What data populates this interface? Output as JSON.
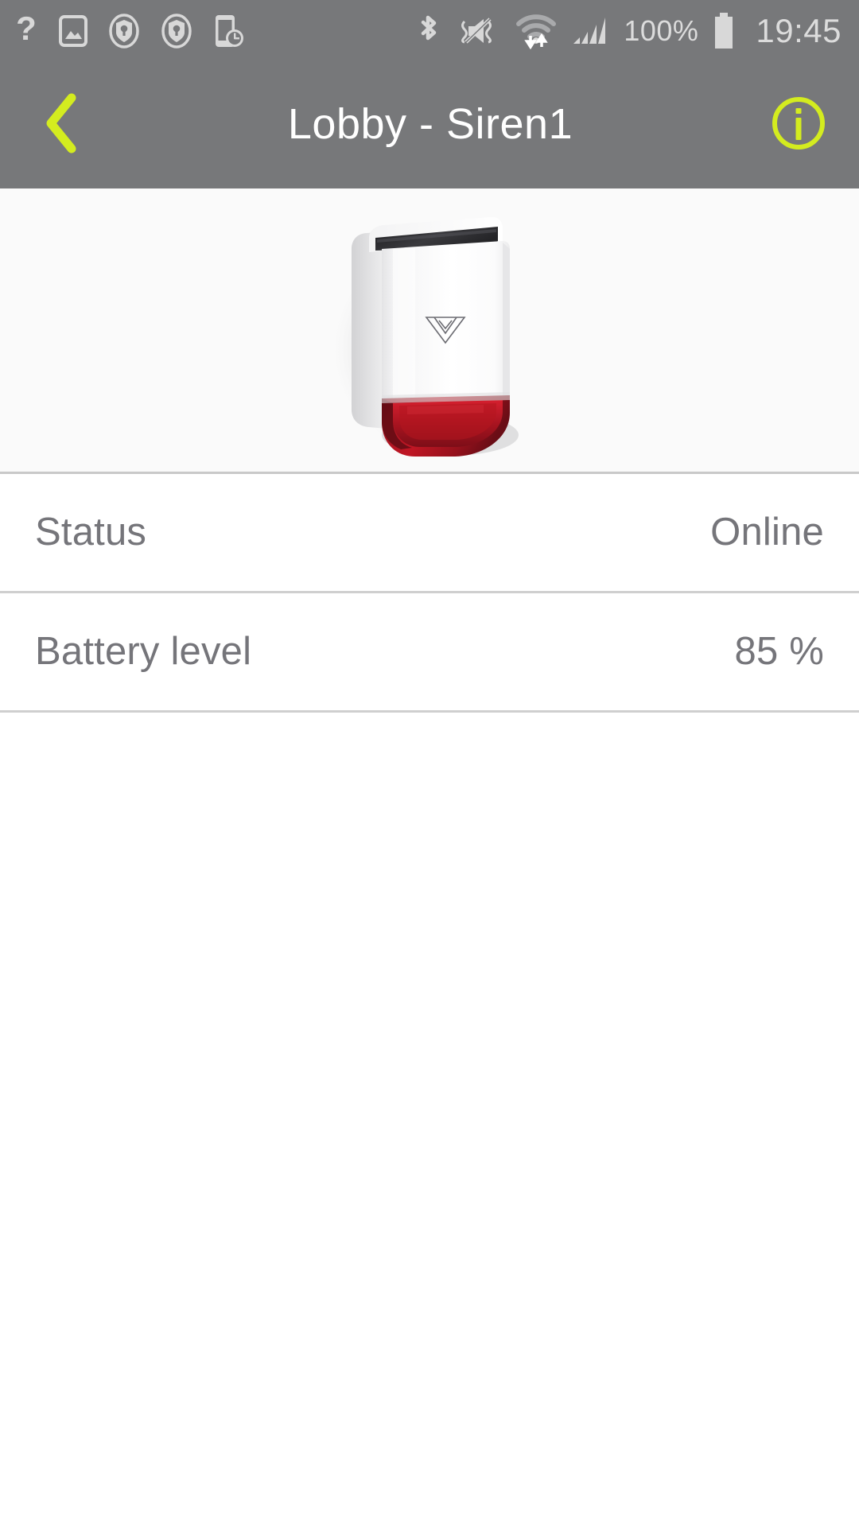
{
  "status_bar": {
    "time": "19:45",
    "battery_percent": "100%",
    "left_icons": [
      {
        "name": "help-question-icon"
      },
      {
        "name": "screenshot-image-icon"
      },
      {
        "name": "shield-key-icon-1"
      },
      {
        "name": "shield-key-icon-2"
      },
      {
        "name": "phone-clock-icon"
      }
    ],
    "right_icons": [
      {
        "name": "bluetooth-icon"
      },
      {
        "name": "sound-mute-vibrate-icon"
      },
      {
        "name": "wifi-data-transfer-icon"
      },
      {
        "name": "cellular-signal-icon"
      },
      {
        "name": "battery-full-icon"
      }
    ]
  },
  "header": {
    "title": "Lobby - Siren1",
    "back_icon": "chevron-left-icon",
    "info_icon": "info-circle-icon",
    "accent_color": "#d4ec1f",
    "background_color": "#77787a",
    "title_color": "#ffffff"
  },
  "device": {
    "image_name": "outdoor-siren-product-photo",
    "logo": "jablotron-w-logo",
    "body_color": "#ffffff",
    "lens_color": "#a81522",
    "solar_strip_color": "#2b2b2d",
    "panel_background": "#fafafa"
  },
  "details": {
    "rows": [
      {
        "label": "Status",
        "value": "Online"
      },
      {
        "label": "Battery level",
        "value": "85 %"
      }
    ],
    "label_color": "#75757a",
    "divider_color": "#cfcfcf"
  }
}
